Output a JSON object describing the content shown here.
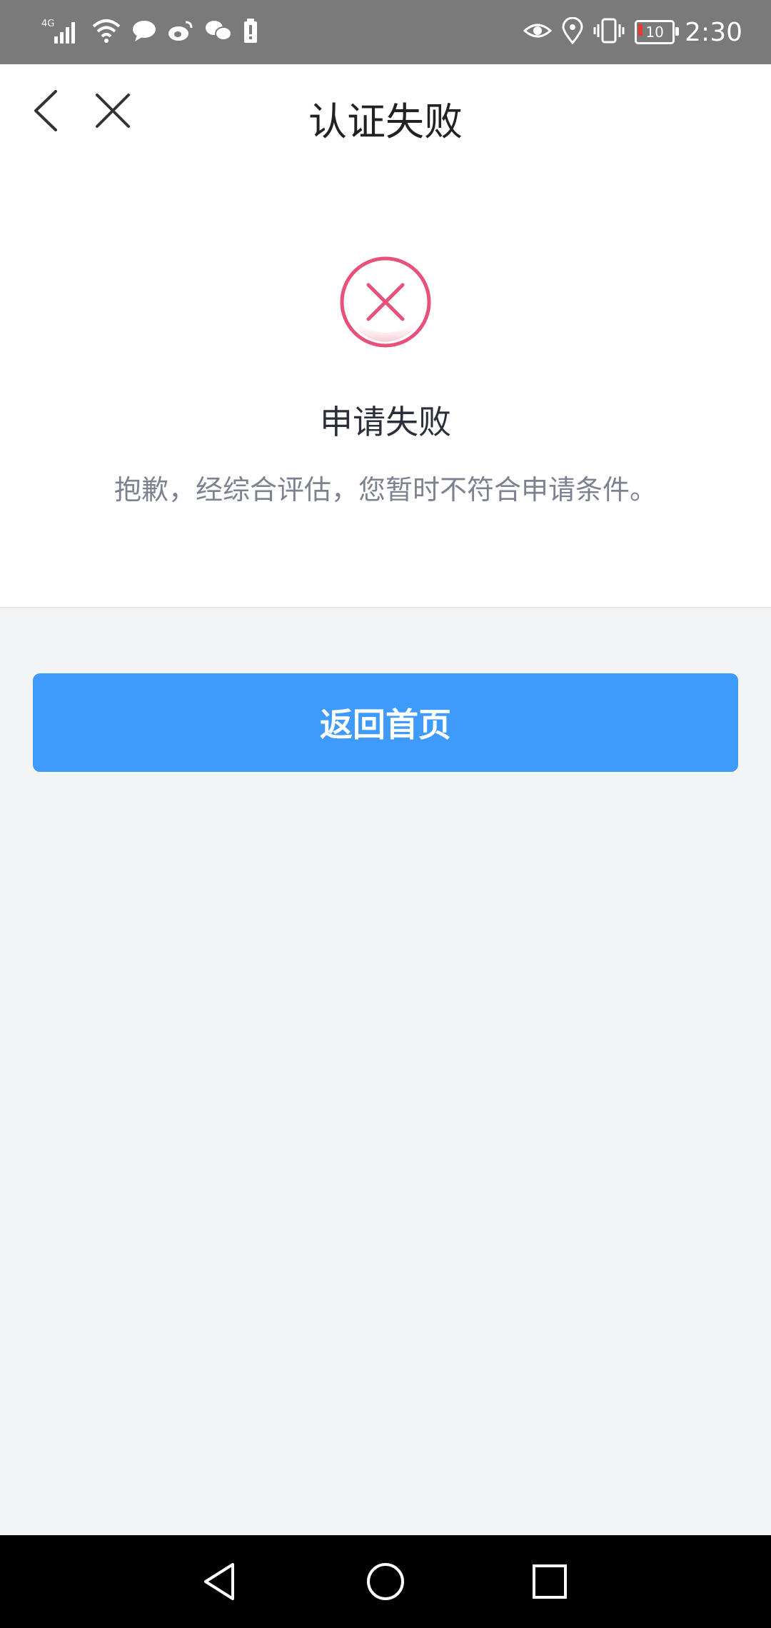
{
  "status_bar": {
    "network": "4G",
    "time": "2:30",
    "battery": "10",
    "icons_left": [
      "signal-icon",
      "wifi-icon",
      "chat-bubble-icon",
      "weibo-icon",
      "wechat-icon",
      "battery-alert-icon"
    ],
    "icons_right": [
      "eye-icon",
      "location-icon",
      "vibrate-icon",
      "battery-icon"
    ]
  },
  "header": {
    "title": "认证失败",
    "back_icon": "chevron-left-icon",
    "close_icon": "close-icon"
  },
  "result": {
    "icon": "error-circle-icon",
    "title": "申请失败",
    "description": "抱歉，经综合评估，您暂时不符合申请条件。"
  },
  "actions": {
    "home_label": "返回首页"
  },
  "colors": {
    "accent": "#3f9bfb",
    "error": "#e8517a",
    "statusbar": "#7a7a7a"
  },
  "system_nav": {
    "back": "triangle-back-icon",
    "home": "circle-home-icon",
    "recents": "square-recents-icon"
  }
}
